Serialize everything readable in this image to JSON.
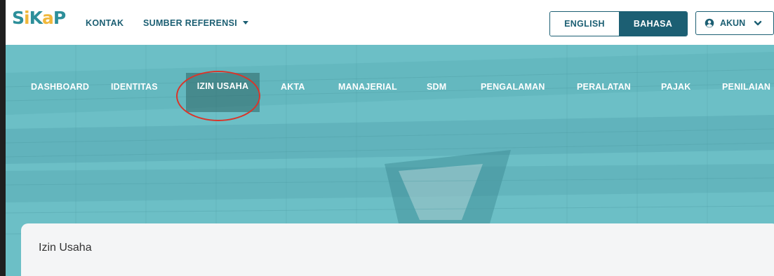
{
  "header": {
    "logo": {
      "letters": [
        "S",
        "i",
        "K",
        "a",
        "P"
      ]
    },
    "links": {
      "kontak": "KONTAK",
      "sumber_referensi": "SUMBER REFERENSI"
    },
    "language": {
      "english": "ENGLISH",
      "bahasa": "BAHASA",
      "selected": "BAHASA"
    },
    "account": {
      "label": "AKUN"
    }
  },
  "main_nav": {
    "items": [
      {
        "label": "DASHBOARD"
      },
      {
        "label": "IDENTITAS"
      },
      {
        "label": "IZIN USAHA",
        "active": true
      },
      {
        "label": "AKTA"
      },
      {
        "label": "MANAJERIAL"
      },
      {
        "label": "SDM"
      },
      {
        "label": "PENGALAMAN"
      },
      {
        "label": "PERALATAN"
      },
      {
        "label": "PAJAK"
      },
      {
        "label": "PENILAIAN"
      }
    ]
  },
  "content": {
    "title": "Izin Usaha"
  },
  "colors": {
    "brand_teal": "#1c5f73",
    "logo_teal": "#2d8f9a",
    "logo_yellow": "#f0b73a",
    "hero_teal": "#62bcc3",
    "highlight_red": "#d9352a"
  }
}
